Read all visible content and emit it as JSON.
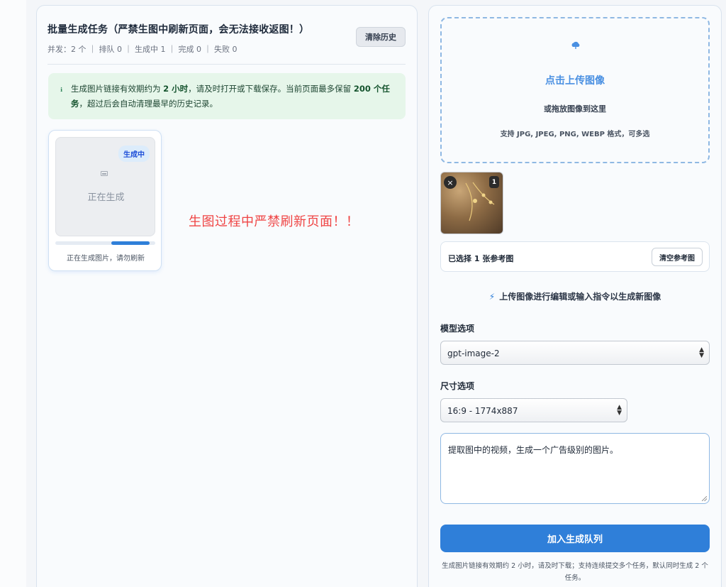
{
  "queue": {
    "title": "批量生成任务（严禁生图中刷新页面，会无法接收返图！）",
    "stats": "并发：2 个 ｜ 排队 0 ｜ 生成中 1 ｜ 完成 0 ｜ 失败 0",
    "clear_history_label": "清除历史",
    "notice": {
      "part1": "生成图片链接有效期约为 ",
      "bold1": "2 小时",
      "part2": "，请及时打开或下载保存。当前页面最多保留 ",
      "bold2": "200 个任务",
      "part3": "，超过后会自动清理最早的历史记录。"
    },
    "tasks": [
      {
        "badge": "生成中",
        "placeholder": "正在生成",
        "status": "正在生成图片，请勿刷新",
        "progress_fraction": 0.38
      }
    ],
    "warning": "生图过程中严禁刷新页面！！"
  },
  "upload": {
    "title": "点击上传图像",
    "subtitle": "或拖放图像到这里",
    "hint": "支持 JPG, JPEG, PNG, WEBP 格式，可多选",
    "thumb_index": "1",
    "thumb_remove": "×",
    "selected_text": "已选择 1 张参考图",
    "clear_ref_label": "清空参考图",
    "instruction": "上传图像进行编辑或输入指令以生成新图像"
  },
  "form": {
    "model_label": "模型选项",
    "model_value": "gpt-image-2",
    "size_label": "尺寸选项",
    "size_value": "16:9 - 1774x887",
    "prompt_text": "提取图中的视频，生成一个广告级别的图片。",
    "submit_label": "加入生成队列",
    "footnote": "生成图片链接有效期约 2 小时，请及时下载；支持连续提交多个任务，默认同时生成 2 个任务。"
  },
  "colors": {
    "accent": "#2f7fd9",
    "notice_bg": "#e6f6ea",
    "warning": "#ef4444"
  }
}
